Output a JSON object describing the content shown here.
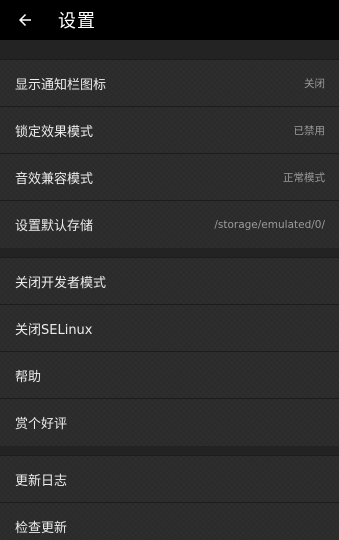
{
  "header": {
    "title": "设置",
    "back_icon": "arrow-back-icon"
  },
  "sections": [
    {
      "items": [
        {
          "label": "显示通知栏图标",
          "value": "关闭"
        },
        {
          "label": "锁定效果模式",
          "value": "已禁用"
        },
        {
          "label": "音效兼容模式",
          "value": "正常模式"
        },
        {
          "label": "设置默认存储",
          "value": "/storage/emulated/0/"
        }
      ]
    },
    {
      "items": [
        {
          "label": "关闭开发者模式"
        },
        {
          "label": "关闭SELinux"
        },
        {
          "label": "帮助"
        },
        {
          "label": "赏个好评"
        }
      ]
    },
    {
      "items": [
        {
          "label": "更新日志"
        },
        {
          "label": "检查更新"
        }
      ]
    }
  ]
}
